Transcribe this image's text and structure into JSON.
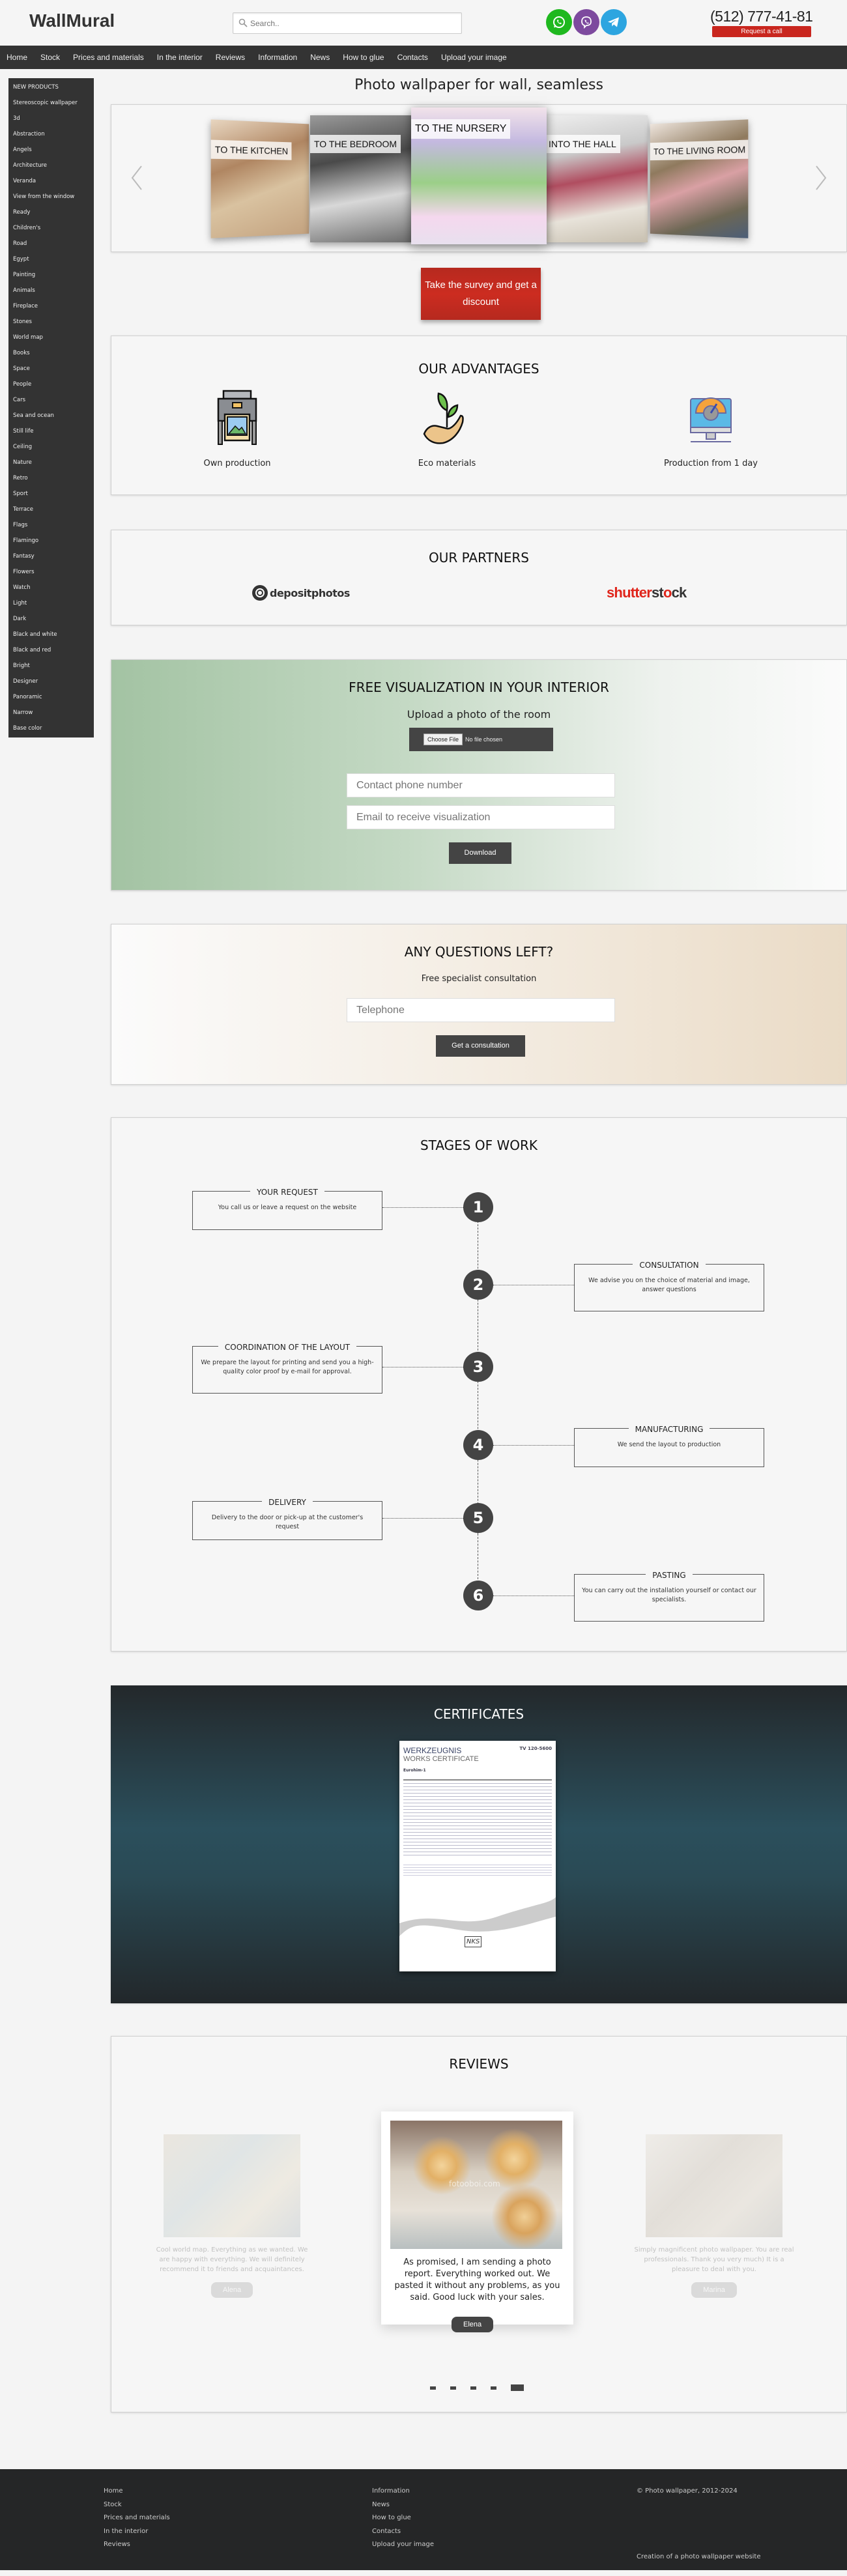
{
  "header": {
    "logo": "WallMural",
    "search_placeholder": "Search..",
    "messengers": [
      {
        "name": "WhatsApp",
        "icon": "whatsapp-icon",
        "color": "#1fb81f"
      },
      {
        "name": "Viber",
        "icon": "viber-icon",
        "color": "#7d4a9e"
      },
      {
        "name": "Telegram",
        "icon": "telegram-icon",
        "color": "#2da5e0"
      }
    ],
    "phone": "(512) 777-41-81",
    "request_call": "Request a call"
  },
  "nav": [
    "Home",
    "Stock",
    "Prices and materials",
    "In the interior",
    "Reviews",
    "Information",
    "News",
    "How to glue",
    "Contacts",
    "Upload your image"
  ],
  "sidebar": [
    "NEW PRODUCTS",
    "Stereoscopic wallpaper",
    "3d",
    "Abstraction",
    "Angels",
    "Architecture",
    "Veranda",
    "View from the window",
    "Ready",
    "Children's",
    "Road",
    "Egypt",
    "Painting",
    "Animals",
    "Fireplace",
    "Stones",
    "World map",
    "Books",
    "Space",
    "People",
    "Cars",
    "Sea and ocean",
    "Still life",
    "Ceiling",
    "Nature",
    "Retro",
    "Sport",
    "Terrace",
    "Flags",
    "Flamingo",
    "Fantasy",
    "Flowers",
    "Watch",
    "Light",
    "Dark",
    "Black and white",
    "Black and red",
    "Bright",
    "Designer",
    "Panoramic",
    "Narrow",
    "Base color"
  ],
  "hero": {
    "title": "Photo wallpaper for wall, seamless",
    "slides": [
      "TO THE KITCHEN",
      "TO THE BEDROOM",
      "TO THE NURSERY",
      "INTO THE HALL",
      "TO THE LIVING ROOM"
    ],
    "survey_button": "Take the survey and get a discount"
  },
  "advantages": {
    "title": "OUR ADVANTAGES",
    "items": [
      {
        "icon": "printer-icon",
        "label": "Own production"
      },
      {
        "icon": "plant-in-hand-icon",
        "label": "Eco materials"
      },
      {
        "icon": "monitor-speedometer-icon",
        "label": "Production from 1 day"
      }
    ]
  },
  "partners": {
    "title": "OUR PARTNERS",
    "items": [
      "depositphotos",
      "shutterstock"
    ]
  },
  "visualization": {
    "title": "FREE VISUALIZATION IN YOUR INTERIOR",
    "subtitle": "Upload a photo of the room",
    "choose_file": "Choose File",
    "no_file": "No file chosen",
    "phone_placeholder": "Contact phone number",
    "email_placeholder": "Email to receive visualization",
    "submit": "Download"
  },
  "questions": {
    "title": "ANY QUESTIONS LEFT?",
    "subtitle": "Free specialist consultation",
    "phone_placeholder": "Telephone",
    "submit": "Get a consultation"
  },
  "stages": {
    "title": "STAGES OF WORK",
    "items": [
      {
        "num": "1",
        "title": "YOUR REQUEST",
        "text": "You call us or leave a request on the website"
      },
      {
        "num": "2",
        "title": "CONSULTATION",
        "text": "We advise you on the choice of material and image, answer questions"
      },
      {
        "num": "3",
        "title": "COORDINATION OF THE LAYOUT",
        "text": "We prepare the layout for printing and send you a high-quality color proof by e-mail for approval."
      },
      {
        "num": "4",
        "title": "MANUFACTURING",
        "text": "We send the layout to production"
      },
      {
        "num": "5",
        "title": "DELIVERY",
        "text": "Delivery to the door or pick-up at the customer's request"
      },
      {
        "num": "6",
        "title": "PASTING",
        "text": "You can carry out the installation yourself or contact our specialists."
      }
    ]
  },
  "certificates": {
    "title": "CERTIFICATES",
    "doc_title_de": "WERKZEUGNIS",
    "doc_title_en": "WORKS CERTIFICATE",
    "doc_code": "TV 120-5600",
    "doc_product": "Eurohim-1",
    "doc_brand": "NKS"
  },
  "reviews": {
    "title": "REVIEWS",
    "items": [
      {
        "text": "Cool world map. Everything as we wanted. We are happy with everything. We will definitely recommend it to friends and acquaintances.",
        "name": "Alena",
        "active": false
      },
      {
        "text": "As promised, I am sending a photo report. Everything worked out. We pasted it without any problems, as you said. Good luck with your sales.",
        "name": "Elena",
        "active": true,
        "watermark": "fotooboi.com"
      },
      {
        "text": "Simply magnificent photo wallpaper. You are real professionals. Thank you very much) It is a pleasure to deal with you.",
        "name": "Marina",
        "active": false
      }
    ],
    "pages": 5,
    "current_page": 5
  },
  "footer": {
    "col1": [
      "Home",
      "Stock",
      "Prices and materials",
      "In the interior",
      "Reviews"
    ],
    "col2": [
      "Information",
      "News",
      "How to glue",
      "Contacts",
      "Upload your image"
    ],
    "copyright": "© Photo wallpaper, 2012-2024",
    "credit": "Creation of a photo wallpaper website"
  }
}
